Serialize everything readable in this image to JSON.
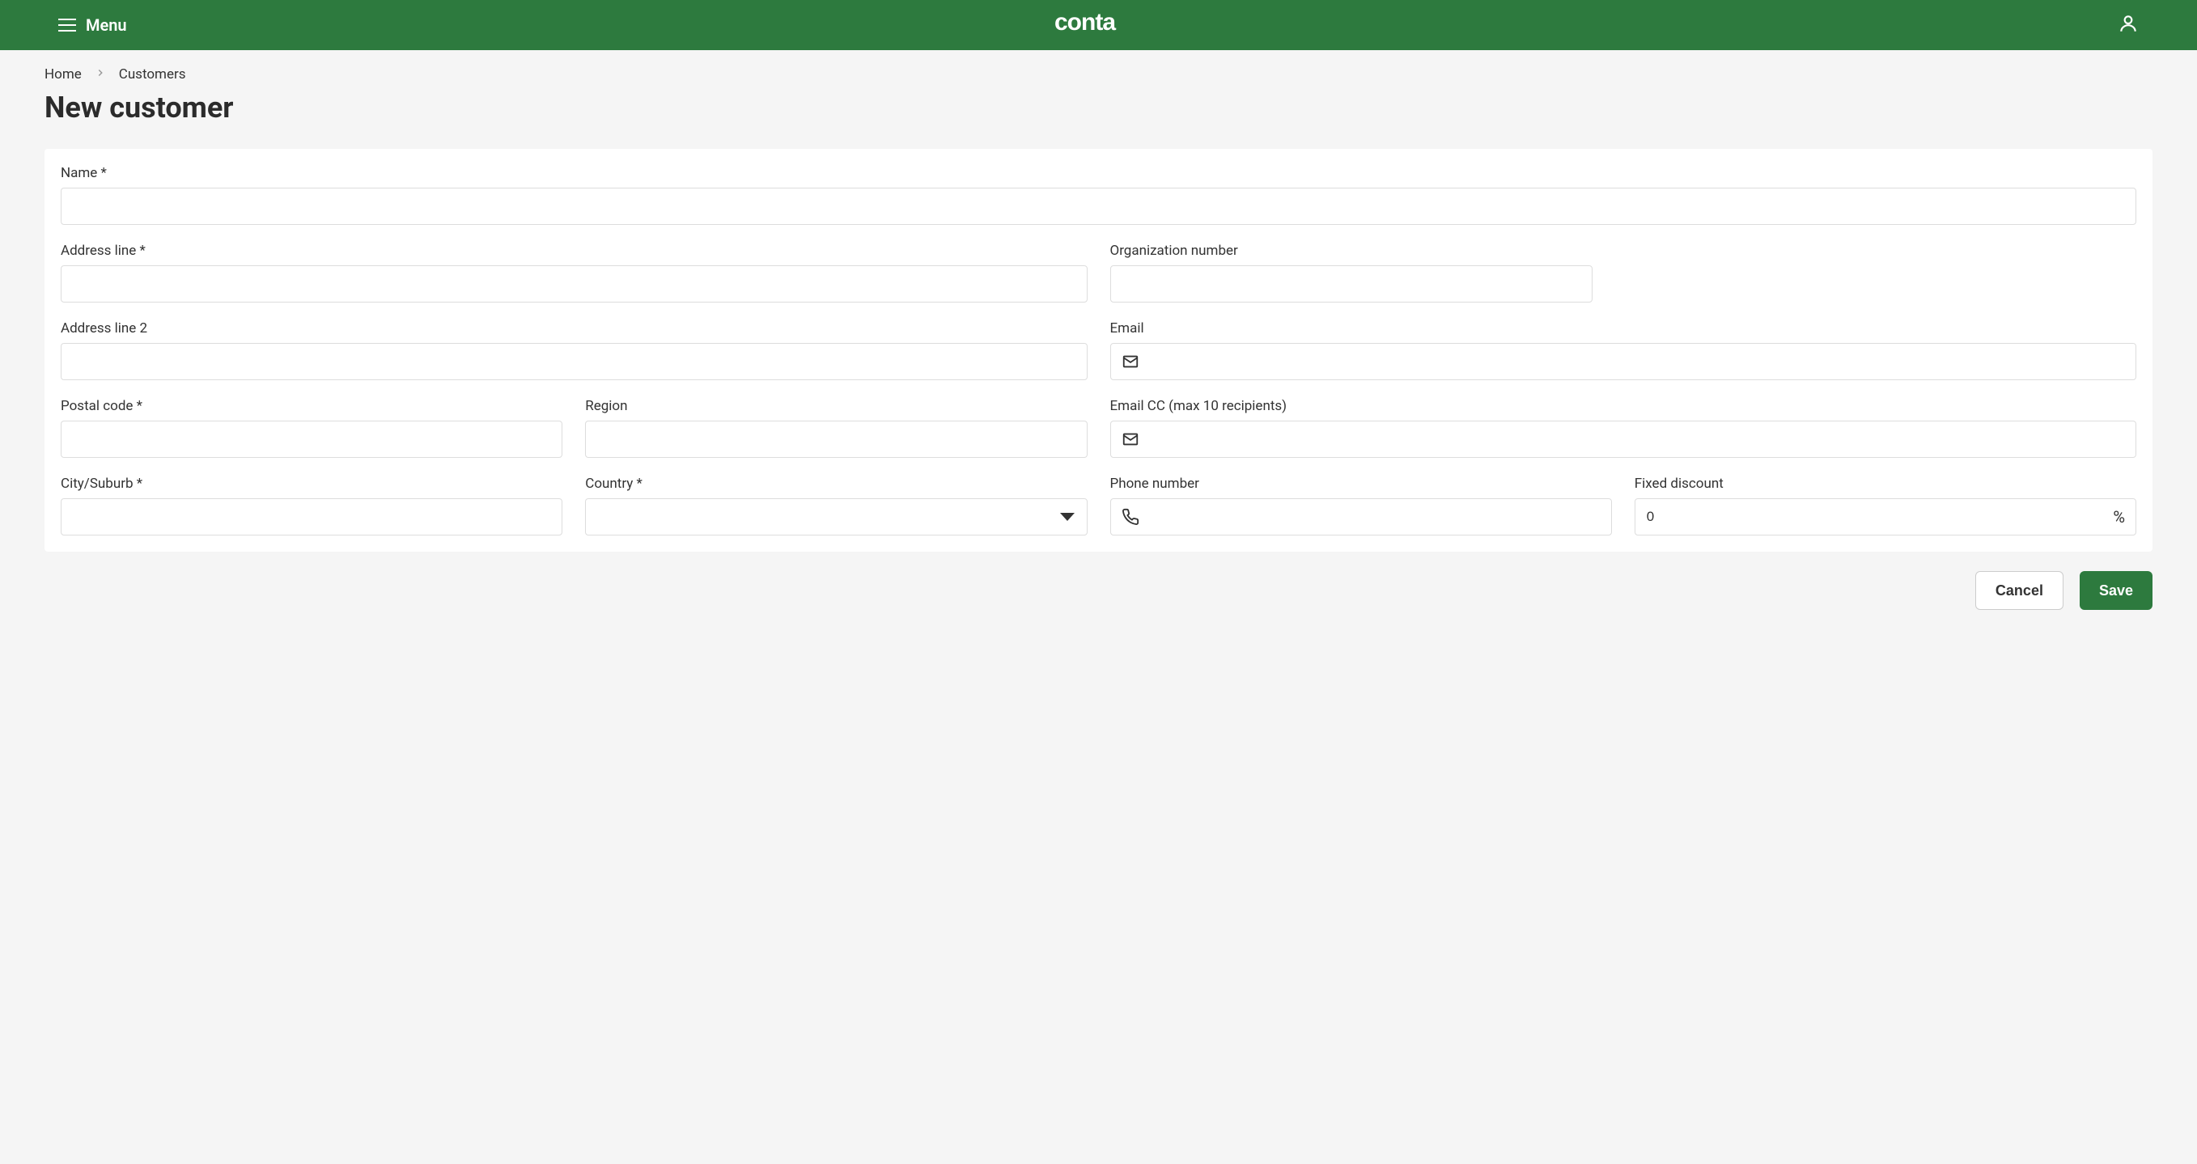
{
  "header": {
    "menu_label": "Menu",
    "logo_text": "conta"
  },
  "breadcrumb": {
    "home": "Home",
    "customers": "Customers"
  },
  "page_title": "New customer",
  "form": {
    "name_label": "Name *",
    "name_value": "",
    "address_line_label": "Address line *",
    "address_line_value": "",
    "address_line2_label": "Address line 2",
    "address_line2_value": "",
    "postal_code_label": "Postal code *",
    "postal_code_value": "",
    "region_label": "Region",
    "region_value": "",
    "city_label": "City/Suburb *",
    "city_value": "",
    "country_label": "Country *",
    "country_value": "",
    "org_number_label": "Organization number",
    "org_number_value": "",
    "email_label": "Email",
    "email_value": "",
    "email_cc_label": "Email CC (max 10 recipients)",
    "email_cc_value": "",
    "phone_label": "Phone number",
    "phone_value": "",
    "discount_label": "Fixed discount",
    "discount_value": "0",
    "discount_suffix": "%"
  },
  "buttons": {
    "cancel": "Cancel",
    "save": "Save"
  }
}
